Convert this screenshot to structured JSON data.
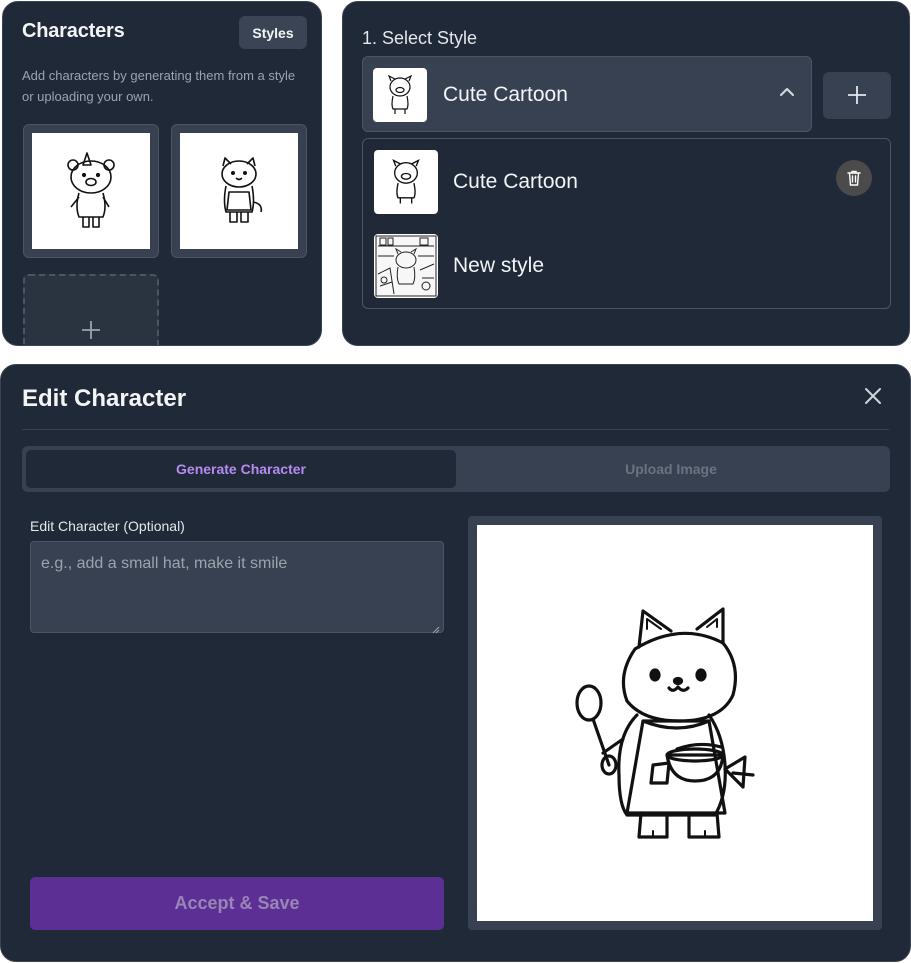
{
  "characters_panel": {
    "title": "Characters",
    "styles_button": "Styles",
    "description": "Add characters by generating them from a style or uploading your own.",
    "character_thumbnails": [
      {
        "icon": "bear-character-icon"
      },
      {
        "icon": "cat-character-icon"
      }
    ],
    "add_icon": "plus-icon"
  },
  "style_panel": {
    "label": "1. Select Style",
    "selected": {
      "label": "Cute Cartoon",
      "icon": "pig-character-icon"
    },
    "chevron_icon": "chevron-up-icon",
    "add_style_icon": "plus-icon",
    "options": [
      {
        "label": "Cute Cartoon",
        "icon": "pig-character-icon"
      },
      {
        "label": "New style",
        "icon": "kitchen-scene-icon"
      }
    ]
  },
  "edit_panel": {
    "title": "Edit Character",
    "close_icon": "close-icon",
    "tabs": [
      {
        "label": "Generate Character",
        "active": true
      },
      {
        "label": "Upload Image",
        "active": false
      }
    ],
    "field_label": "Edit Character (Optional)",
    "field_placeholder": "e.g., add a small hat, make it smile",
    "field_value": "",
    "accept_button": "Accept & Save",
    "preview_icon": "cat-chef-character-icon",
    "delete_icon": "trash-icon"
  },
  "colors": {
    "panel_bg": "#1f2937",
    "surface": "#374151",
    "accent_purple": "#b58bf2",
    "button_purple": "#5b2f93"
  }
}
